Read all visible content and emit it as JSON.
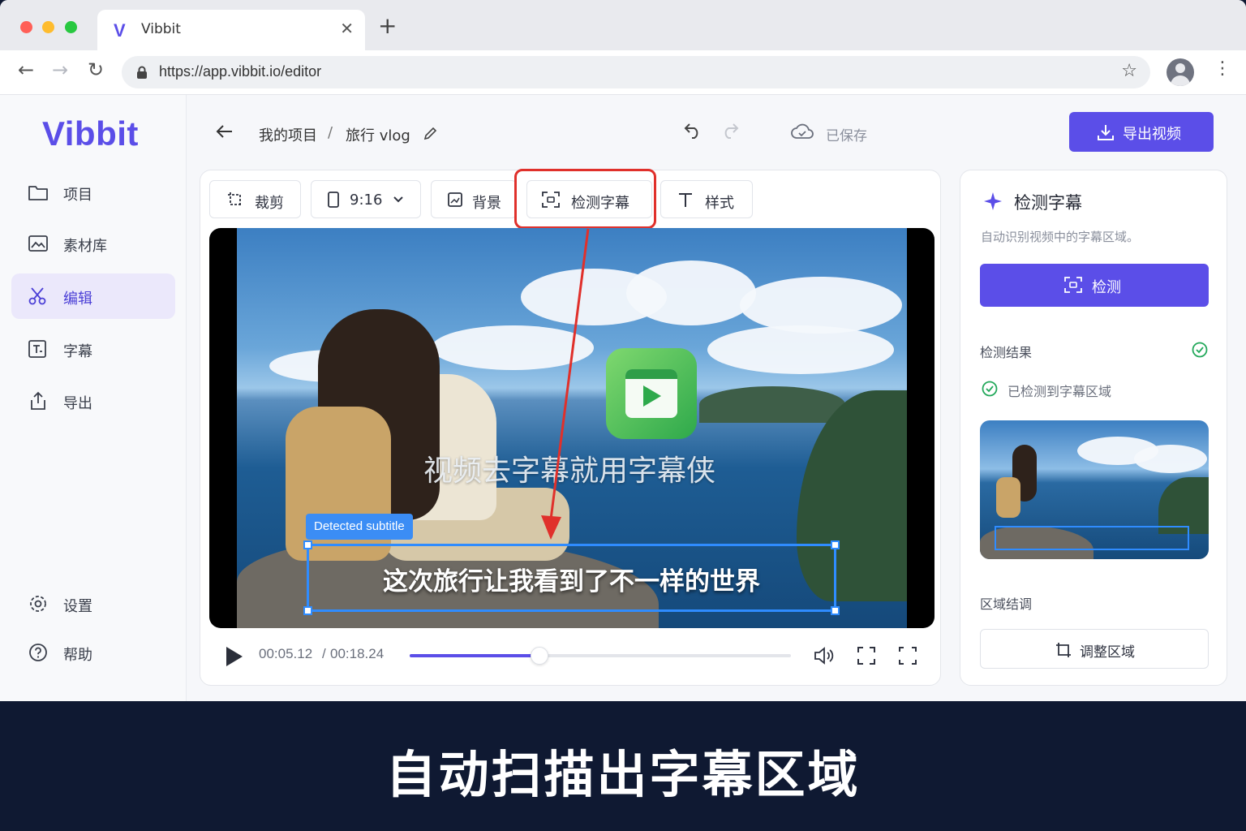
{
  "browser": {
    "tab_title": "Vibbit",
    "tab_logo": "V",
    "url": "https://app.vibbit.io/editor"
  },
  "sidebar": {
    "brand": "Vibbit",
    "items": [
      {
        "label": "项目",
        "icon": "folder-icon"
      },
      {
        "label": "素材库",
        "icon": "image-icon"
      },
      {
        "label": "编辑",
        "icon": "scissors-icon",
        "active": true
      },
      {
        "label": "字幕",
        "icon": "subtitle-icon"
      },
      {
        "label": "导出",
        "icon": "share-icon"
      }
    ],
    "bottom_items": [
      {
        "label": "设置",
        "icon": "gear-icon"
      },
      {
        "label": "帮助",
        "icon": "help-icon"
      }
    ]
  },
  "header": {
    "breadcrumb_root": "我的项目",
    "breadcrumb_sep": "/",
    "project_name": "旅行 vlog",
    "save_status": "已保存",
    "export_label": "导出视频"
  },
  "toolbar": {
    "crop": "裁剪",
    "ratio": "9:16",
    "background": "背景",
    "detect": "检测字幕",
    "style": "样式"
  },
  "video": {
    "watermark_text": "视频去字幕就用字幕侠",
    "detect_tag": "Detected subtitle",
    "subtitle_text": "这次旅行让我看到了不一样的世界",
    "current_time": "00:05.12",
    "time_sep": "/",
    "total_time": "00:18.24",
    "progress": 0.34
  },
  "panel": {
    "title": "检测字幕",
    "description": "自动识别视频中的字幕区域。",
    "detect_button": "检测",
    "result_label": "检测结果",
    "result_text": "已检测到字幕区域",
    "region_label": "区域结调",
    "adjust_button": "调整区域"
  },
  "caption": "自动扫描出字幕区域",
  "colors": {
    "accent": "#5b4ee8",
    "highlight": "#e0302b",
    "detect_box": "#2f8cff",
    "success": "#22a85a",
    "caption_bg": "#0f1932"
  }
}
